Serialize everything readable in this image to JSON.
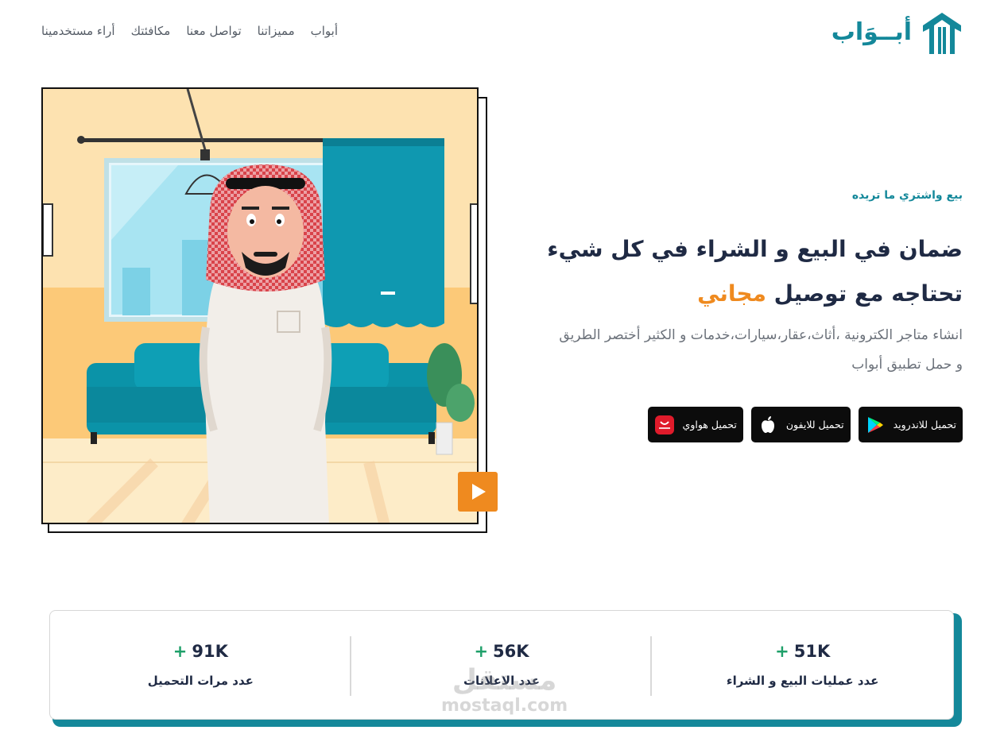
{
  "header": {
    "logo_text": "أبــوَاب",
    "nav": [
      "أبواب",
      "مميزاتنا",
      "تواصل معنا",
      "مكافئتك",
      "أراء مستخدمينا"
    ]
  },
  "hero": {
    "eyebrow": "بيع واشتري ما تريده",
    "headline_line1": "ضمان في البيع و الشراء في كل شيء",
    "headline_line2_prefix": "تحتاجه مع توصيل ",
    "headline_line2_accent": "مجاني",
    "description_line1": "انشاء متاجر الكترونية ،أثاث،عقار،سيارات،خدمات و الكثير أختصر الطريق",
    "description_line2": "و حمل تطبيق أبواب"
  },
  "stores": [
    {
      "label": "تحميل للاندرويد",
      "icon": "google-play-icon"
    },
    {
      "label": "تحميل للايفون",
      "icon": "apple-icon"
    },
    {
      "label": "تحميل هواوي",
      "icon": "huawei-appgallery-icon"
    }
  ],
  "stats": [
    {
      "value": "51K",
      "plus": "+",
      "label": "عدد عمليات البيع و الشراء"
    },
    {
      "value": "56K",
      "plus": "+",
      "label": "عدد الاعلانات"
    },
    {
      "value": "91K",
      "plus": "+",
      "label": "عدد مرات التحميل"
    }
  ],
  "watermark": {
    "line1": "مستقل",
    "line2": "mostaql.com"
  },
  "colors": {
    "teal": "#14889a",
    "orange": "#ef8a1f",
    "dark": "#1f2a44",
    "green": "#1fa06a"
  }
}
